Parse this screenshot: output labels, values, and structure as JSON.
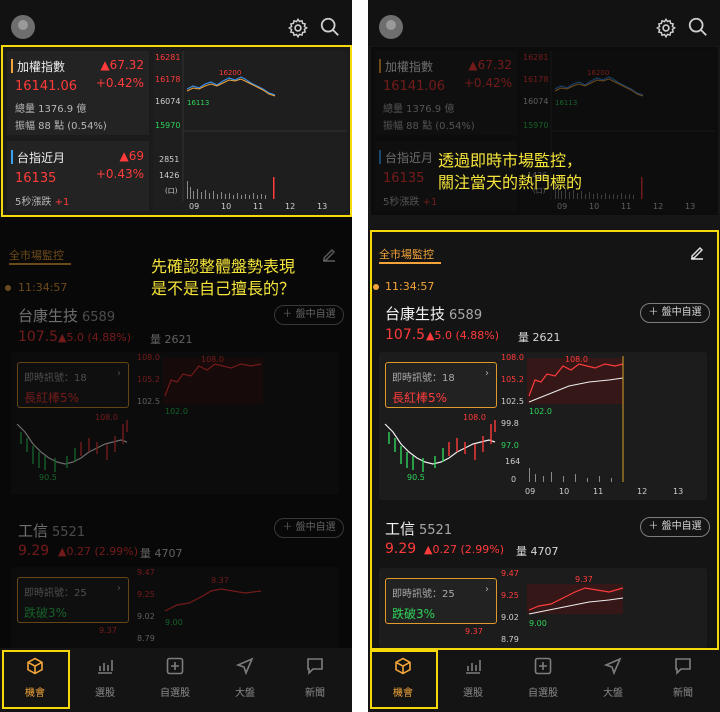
{
  "annotations": {
    "left": "先確認整體盤勢表現\n是不是自己擅長的？",
    "right": "透過即時市場監控，\n關注當天的熱門標的"
  },
  "index_panel": {
    "taiex": {
      "name": "加權指數",
      "value": "16141.06",
      "change": "▲67.32",
      "change_pct": "+0.42%",
      "volume": "總量 1376.9 億",
      "amplitude": "振幅 88 點 (0.54%)"
    },
    "futures": {
      "name": "台指近月",
      "value": "16135",
      "change": "▲69",
      "change_pct": "+0.43%",
      "five_sec_label": "5秒漲跌",
      "five_sec_value": "+1"
    },
    "chart_axis": {
      "y_labels": [
        "16281",
        "16178",
        "16074",
        "15970"
      ],
      "vol_labels": [
        "2851",
        "1426",
        "(口)"
      ],
      "x_labels": [
        "09",
        "10",
        "11",
        "12",
        "13"
      ],
      "high_label": "16200",
      "low_label": "16113"
    }
  },
  "monitor": {
    "tab_label": "全市場監控",
    "time": "11:34:57",
    "add_label": "＋ 盤中自選"
  },
  "stocks": [
    {
      "name": "台康生技",
      "code": "6589",
      "price": "107.5",
      "change": "▲5.0",
      "change_pct": "(4.88%)",
      "volume_label": "量",
      "volume": "2621",
      "signal_label": "即時訊號：18",
      "signal": "長紅棒5%",
      "signal_color": "#ff3b3b",
      "left_high": "108.0",
      "left_low": "90.5",
      "right_y": [
        "108.0",
        "105.2",
        "102.5",
        "99.8",
        "97.0",
        "164",
        "0"
      ],
      "right_top": "108.0",
      "right_base": "102.0",
      "x_labels": [
        "09",
        "10",
        "11",
        "12",
        "13"
      ]
    },
    {
      "name": "工信",
      "code": "5521",
      "price": "9.29",
      "change": "▲0.27",
      "change_pct": "(2.99%)",
      "volume_label": "量",
      "volume": "4707",
      "signal_label": "即時訊號：25",
      "signal": "跌破3%",
      "signal_color": "#2fd35a",
      "left_high": "9.37",
      "right_y": [
        "9.47",
        "9.25",
        "9.02",
        "8.79"
      ],
      "right_top": "9.37",
      "right_base": "9.00"
    }
  ],
  "nav": {
    "items": [
      {
        "label": "機會",
        "icon": "cube-icon"
      },
      {
        "label": "選股",
        "icon": "chart-icon"
      },
      {
        "label": "自選股",
        "icon": "plus-square-icon"
      },
      {
        "label": "大盤",
        "icon": "navigation-icon"
      },
      {
        "label": "新聞",
        "icon": "message-icon"
      }
    ]
  },
  "colors": {
    "highlight": "#f5d90a",
    "accent": "#f2a43a",
    "up": "#ff3b3b",
    "down": "#2fd35a"
  }
}
